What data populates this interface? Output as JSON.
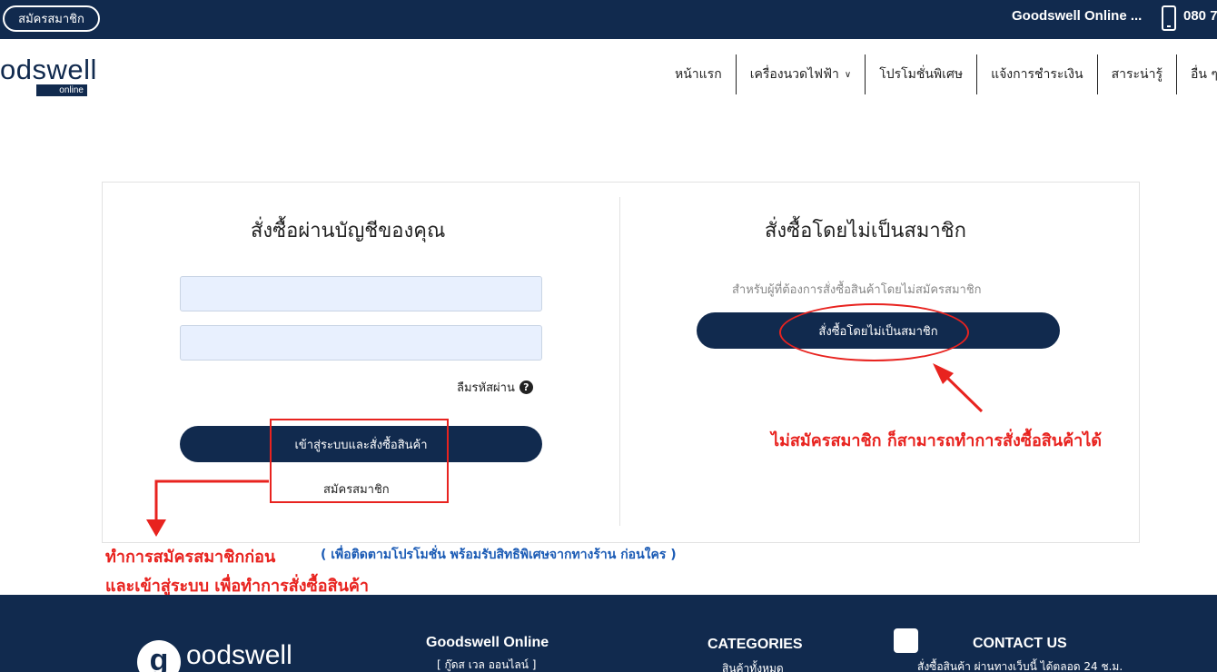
{
  "topbar": {
    "signup_label": "สมัครสมาชิก",
    "brand": "Goodswell Online ...",
    "phone_icon": "phone-icon",
    "phone": "080 7"
  },
  "header": {
    "logo_text": "odswell",
    "logo_sub": "online",
    "nav": [
      {
        "label": "หน้าแรก"
      },
      {
        "label": "เครื่องนวดไฟฟ้า",
        "chevron": "chevron-down-icon"
      },
      {
        "label": "โปรโมชั่นพิเศษ"
      },
      {
        "label": "แจ้งการชำระเงิน"
      },
      {
        "label": "สาระน่ารู้"
      },
      {
        "label": "อื่น ๆ"
      }
    ]
  },
  "login": {
    "heading": "สั่งซื้อผ่านบัญชีของคุณ",
    "username_value": "",
    "password_value": "",
    "forgot_label": "ลืมรหัสผ่าน",
    "forgot_icon": "question-circle-icon",
    "submit_label": "เข้าสู่ระบบและสั่งซื้อสินค้า",
    "signup_link": "สมัครสมาชิก"
  },
  "guest": {
    "heading": "สั่งซื้อโดยไม่เป็นสมาชิก",
    "description": "สำหรับผู้ที่ต้องการสั่งซื้อสินค้าโดยไม่สมัครสมาชิก",
    "button_label": "สั่งซื้อโดยไม่เป็นสมาชิก"
  },
  "annotations": {
    "note_signup_first": "ทำการสมัครสมาชิกก่อน",
    "note_benefits": "( เพื่อติดตามโปรโมชั่น พร้อมรับสิทธิพิเศษจากทางร้าน ก่อนใคร )",
    "note_login_to_order": "และเข้าสู่ระบบ เพื่อทำการสั่งซื้อสินค้า",
    "note_guest": "ไม่สมัครสมาชิก ก็สามารถทำการสั่งซื้อสินค้าได้",
    "annotation_color": "#e8231f",
    "benefit_color": "#1b5bb5"
  },
  "footer": {
    "logo_letter": "g",
    "logo_text": "oodswell",
    "col1_title": "Goodswell Online",
    "col1_sub": "[ กู๊ดส เวล ออนไลน์ ]",
    "col2_title": "CATEGORIES",
    "col2_sub": "สินค้าทั้งหมด",
    "col3_title": "CONTACT US",
    "col3_sub": "สั่งซื้อสินค้า ผ่านทางเว็บนี้ ได้ตลอด 24 ช.ม."
  },
  "colors": {
    "brand_navy": "#112a4e",
    "input_bg": "#e8f0fe"
  }
}
